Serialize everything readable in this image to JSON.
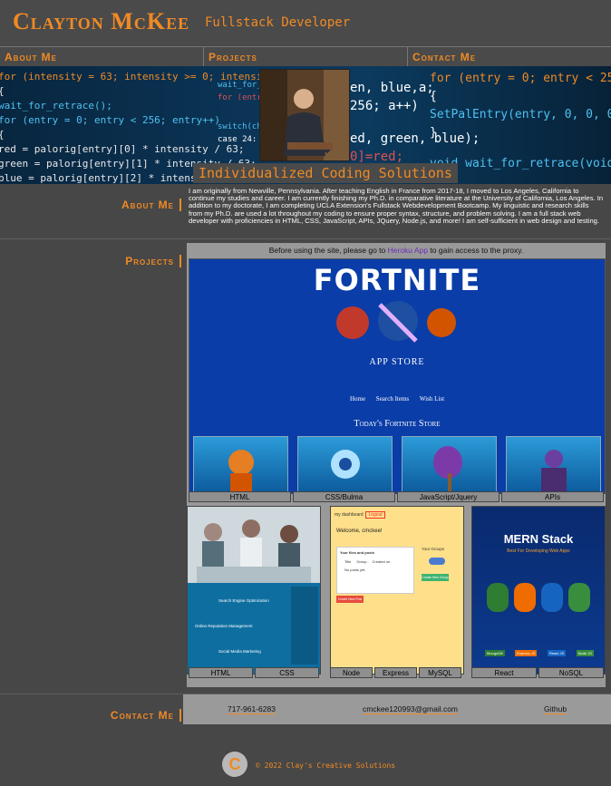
{
  "header": {
    "name": "Clayton McKee",
    "role": "Fullstack Developer"
  },
  "nav": [
    "About Me",
    "Projects",
    "Contact Me"
  ],
  "hero": {
    "tagline": "Individualized Coding Solutions",
    "code_left": [
      "for (intensity = 63; intensity >= 0; intensity--)",
      "{",
      "  wait_for_retrace();",
      "  for (entry = 0; entry < 256; entry++)",
      "  {",
      "    red   = palorig[entry][0] * intensity / 63;",
      "    green = palorig[entry][1] * intensity / 63;",
      "    blue  = palorig[entry][2] * intensity / 63;"
    ],
    "code_mid": [
      "wait_for_",
      "for (entry",
      "switch(char",
      "case 24:"
    ],
    "code_center": [
      "en, blue,a;",
      "256; a++)",
      "ed, green, blue);",
      "0]=red;"
    ],
    "code_right": [
      "for (entry = 0; entry  < 256; entry",
      "{",
      "  SetPalEntry(entry, 0, 0, 0);",
      "}",
      "void wait_for_retrace(void)"
    ]
  },
  "about": {
    "label": "About Me",
    "text": "I am originally from Newville, Pennsylvania. After teaching English in France from 2017-18, I moved to Los Angeles, California to continue my studies and career. I am currently finishing my Ph.D. in comparative literature at the University of California, Los Angeles. In addition to my doctorate, I am completing UCLA Extension's Fullstack Webdevelopment Bootcamp. My linguistic and research skills from my Ph.D. are used a lot throughout my coding to ensure proper syntax, structure, and problem solving. I am a full stack web developer with proficiencies in HTML, CSS, JavaScript, APIs, JQuery, Node.js, and more! I am self-sufficient in web design and testing."
  },
  "projects": {
    "label": "Projects",
    "notice_before": "Before using the site, please go to ",
    "notice_link": "Heroku App",
    "notice_after": " to gain access to the proxy.",
    "fortnite": {
      "logo": "FORTNITE",
      "store": "APP STORE",
      "nav": [
        "Home",
        "Search Items",
        "Wish List"
      ],
      "today": "Today's Fortnite Store",
      "tags": [
        "HTML",
        "CSS/Bulma",
        "JavaScript/Jquery",
        "APIs"
      ]
    },
    "seo": {
      "tags": [
        "HTML",
        "CSS"
      ],
      "items": [
        "Search Engine Optimization",
        "Online Reputation Management",
        "Social Media Marketing"
      ]
    },
    "groups": {
      "title": "Welcome, cmckee!",
      "panel": "Your files and posts",
      "groups_label": "Your Groups",
      "cols": [
        "Title",
        "Group",
        "Created on"
      ],
      "empty": "No posts yet.",
      "create": "Create New Group",
      "new_post": "Create New Post",
      "tags": [
        "Node",
        "Express",
        "MySQL"
      ]
    },
    "mern": {
      "title": "MERN Stack",
      "subtitle": "Best For Developing Web Apps",
      "badges": [
        "MongoDB",
        "Express JS",
        "React JS",
        "Node JS"
      ],
      "tags": [
        "React",
        "NoSQL"
      ]
    }
  },
  "contact": {
    "label": "Contact Me",
    "phone": "717-961-6283",
    "email": "cmckee120993@gmail.com",
    "github": "Github"
  },
  "footer": {
    "logo_letter": "C",
    "copyright": "© 2022 Clay's Creative Solutions"
  },
  "colors": {
    "accent": "#f08a24",
    "background": "#474747",
    "panel": "#999999"
  }
}
